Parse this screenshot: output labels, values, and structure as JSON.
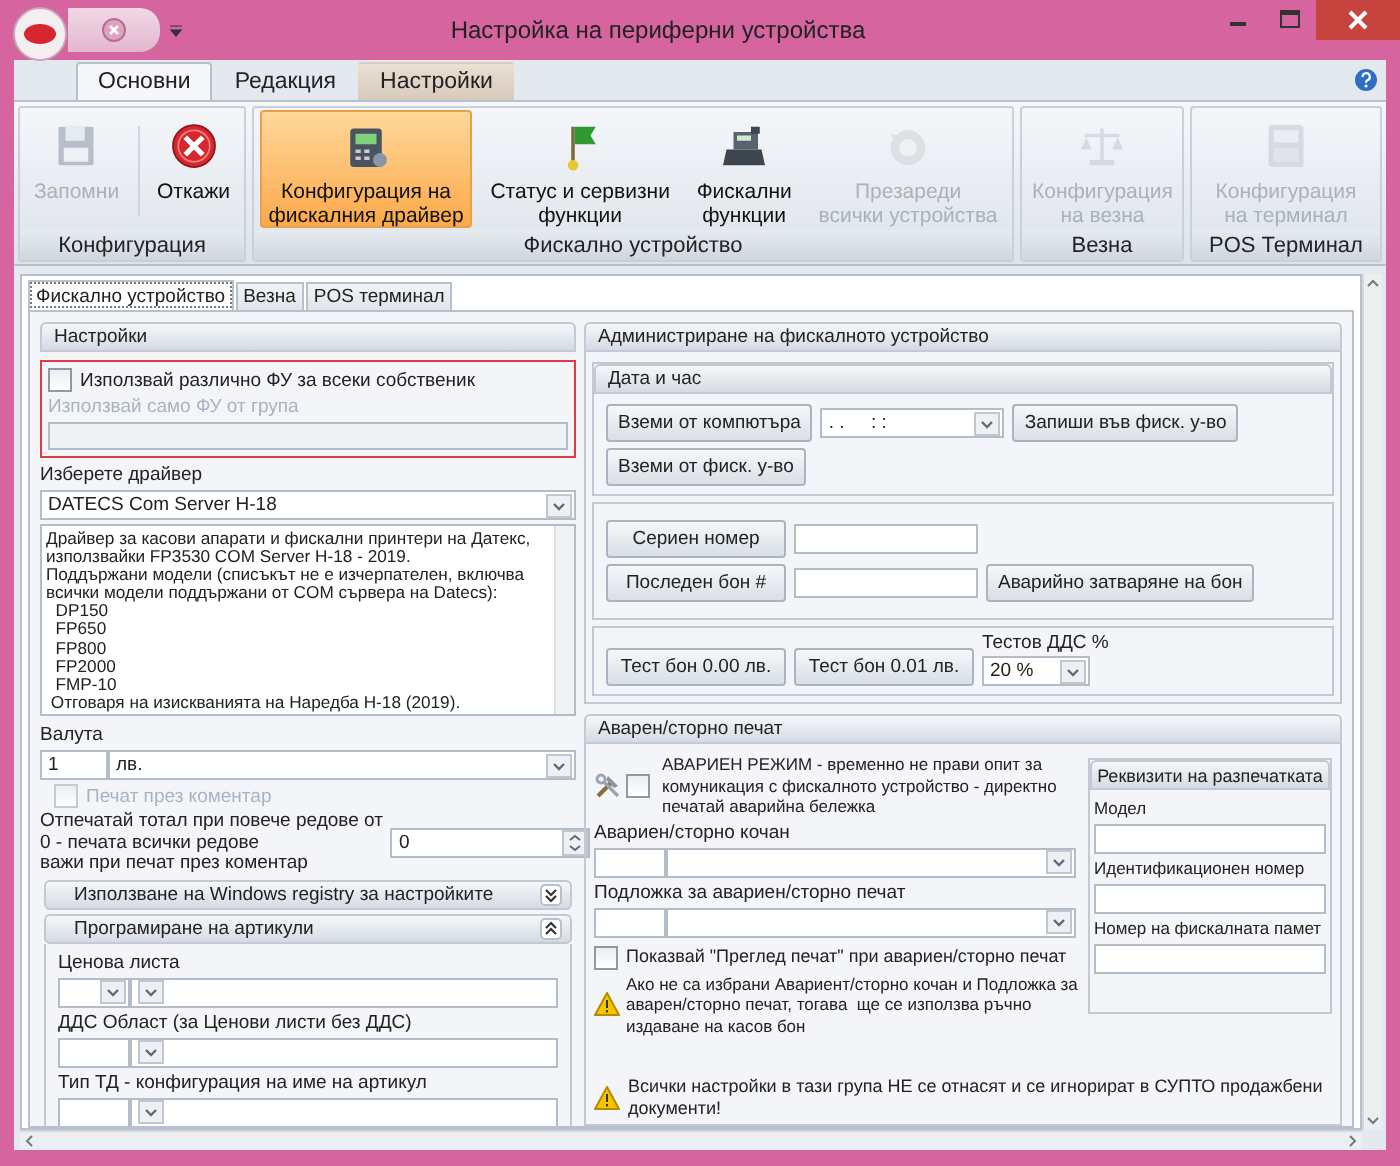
{
  "window": {
    "title": "Настройка на периферни устройства"
  },
  "ribbon_tabs": [
    {
      "label": "Основни",
      "selected": true,
      "contextual": false
    },
    {
      "label": "Редакция",
      "selected": false,
      "contextual": false
    },
    {
      "label": "Настройки",
      "selected": false,
      "contextual": true
    }
  ],
  "ribbon_groups": [
    {
      "label": "Конфигурация",
      "buttons": [
        {
          "label": "Запомни",
          "selected": false,
          "disabled": true
        },
        {
          "label": "Откажи",
          "selected": false,
          "disabled": false
        }
      ]
    },
    {
      "label": "Фискално устройство",
      "buttons": [
        {
          "label": "Конфигурация на\nфискалния драйвер",
          "selected": true,
          "disabled": false
        },
        {
          "label": "Статус и сервизни\nфункции",
          "selected": false,
          "disabled": false
        },
        {
          "label": "Фискални\nфункции",
          "selected": false,
          "disabled": false
        },
        {
          "label": "Презареди\nвсички устройства",
          "selected": false,
          "disabled": true
        }
      ]
    },
    {
      "label": "Везна",
      "buttons": [
        {
          "label": "Конфигурация\nна везна",
          "selected": false,
          "disabled": true
        }
      ]
    },
    {
      "label": "POS Терминал",
      "buttons": [
        {
          "label": "Конфигурация\nна терминал",
          "selected": false,
          "disabled": true
        }
      ]
    }
  ],
  "page_tabs": [
    {
      "label": "Фискално устройство",
      "selected": true
    },
    {
      "label": "Везна",
      "selected": false
    },
    {
      "label": "POS терминал",
      "selected": false
    }
  ],
  "settings": {
    "title": "Настройки",
    "different_device": {
      "label": "Използвай различно ФУ за всеки собственик",
      "checked": false
    },
    "group_label": "Използвай само ФУ от група",
    "driver_label": "Изберете драйвер",
    "driver_value": "DATECS Com Server H-18",
    "driver_description": "Драйвер за касови апарати и фискални принтери на Датекс,\nизползвайки FP3530 COM Server H-18 - 2019.\nПоддържани модели (списъкът не е изчерпателен, включва\nвсички модели поддържани от COM сървера на Datecs):\n  DP150\n  FP650\n  FP800\n  FP2000\n  FMP-10\n Отговаря на изискванията на Наредба Н-18 (2019).",
    "currency_label": "Валута",
    "currency_amount": "1",
    "currency_value": "лв.",
    "print_comment": {
      "label": "Печат през коментар",
      "checked": false,
      "disabled": true
    },
    "total_label": "Отпечатай тотал при повече редове от\n0 - печата всички редове\nважи при печат през коментар",
    "total_value": "0",
    "sections": [
      {
        "title": "Използване на Windows registry за настройките",
        "expanded": false
      },
      {
        "title": "Програмиране на артикули",
        "expanded": true,
        "fields": [
          {
            "label": "Ценова листа",
            "kind": "split_dropdown"
          },
          {
            "label": "ДДС Област (за Ценови листи без ДДС)",
            "kind": "split"
          },
          {
            "label": "Тип ТД - конфигурация на име на артикул",
            "kind": "split"
          }
        ]
      }
    ]
  },
  "admin": {
    "title": "Администриране на фискалното устройство",
    "datetime": {
      "title": "Дата и час",
      "from_pc": "Вземи от компютъра",
      "value": ". .     : :",
      "write": "Запиши във фиск. у-во",
      "from_device": "Вземи от фиск. у-во"
    },
    "serial_button": "Сериен номер",
    "last_receipt_button": "Последен бон #",
    "emergency_close_button": "Аварийно затваряне на бон",
    "test_buttons": [
      "Тест бон 0.00 лв.",
      "Тест бон 0.01 лв."
    ],
    "vat_label": "Тестов ДДС %",
    "vat_value": "20 %"
  },
  "emergency": {
    "title": "Аварен/сторно печат",
    "mode": {
      "label": "АВАРИЕН РЕЖИМ - временно не прави опит за\nкомуникация с фискалното устройство - директно\nпечатай аварийна бележка",
      "checked": false
    },
    "fields": [
      {
        "label": "Авариен/сторно кочан"
      },
      {
        "label": "Подложка за авариен/сторно печат"
      }
    ],
    "preview": {
      "label": "Показвай \"Преглед печат\" при авариен/сторно печат",
      "checked": false
    },
    "warning": "Ако не са избрани Авариент/сторно кочан и Подложка за\nаварен/сторно печат, тогава  ще се използва ръчно\nиздаване на касов бон",
    "receipt": {
      "title": "Реквизити на разпечатката",
      "fields": [
        {
          "label": "Модел"
        },
        {
          "label": "Идентификационен номер"
        },
        {
          "label": "Номер на фискалната памет"
        }
      ]
    },
    "footer": "Всички настройки в тази група НЕ се отнасят и се игнорират в СУПТО продажбени документи!"
  }
}
